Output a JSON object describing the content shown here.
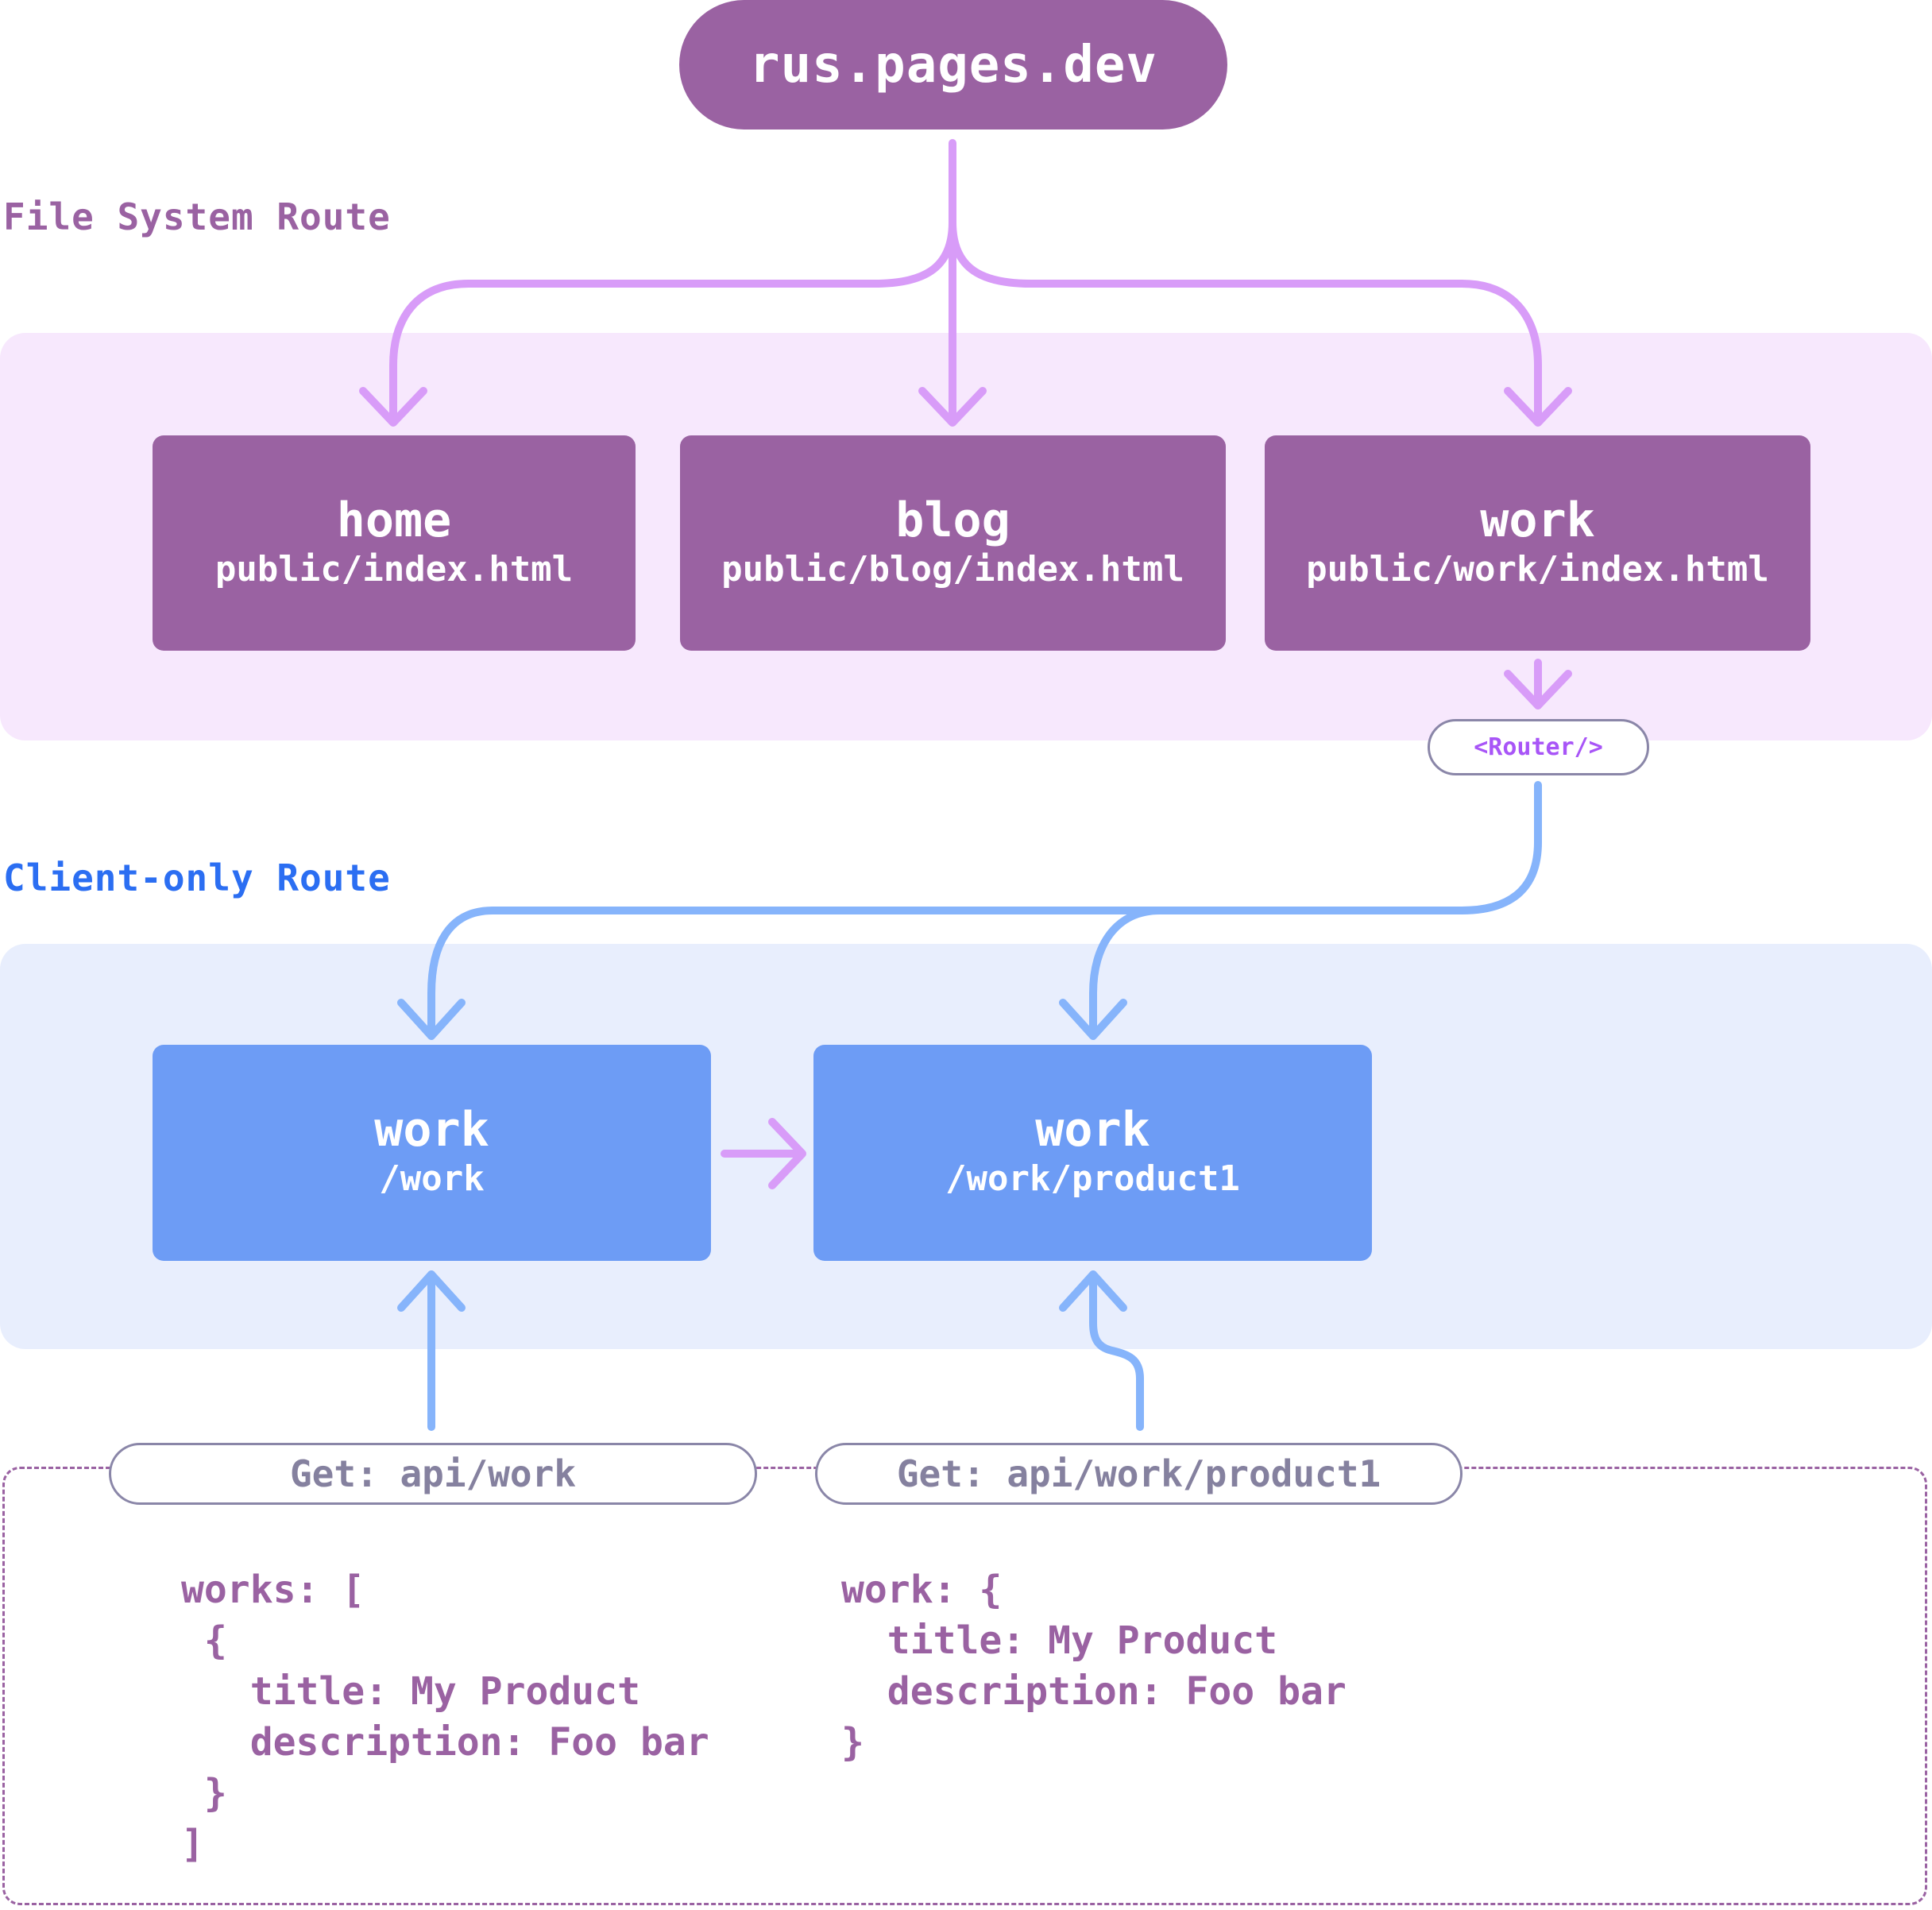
{
  "domain_title": "rus.pages.dev",
  "colors": {
    "purple": "#9a62a2",
    "purple_light_panel": "#f7e8fd",
    "purple_arrow": "#d89cf8",
    "blue": "#6d9cf5",
    "blue_light_panel": "#e8eefd",
    "blue_arrow": "#86b4fb",
    "client_label": "#2b6ef2",
    "router_text": "#a855f7",
    "pill_border": "#8a86a8",
    "get_text": "#85819f"
  },
  "file_system": {
    "label": "File System Route",
    "routes": [
      {
        "title": "home",
        "path": "public/index.html"
      },
      {
        "title": "blog",
        "path": "public/blog/index.html"
      },
      {
        "title": "work",
        "path": "public/work/index.html"
      }
    ],
    "router_label": "<Router/>"
  },
  "client_only": {
    "label": "Client-only Route",
    "routes": [
      {
        "title": "work",
        "path": "/work"
      },
      {
        "title": "work",
        "path": "/work/product1"
      }
    ]
  },
  "api": {
    "requests": [
      {
        "label": "Get: api/work",
        "response_lines": [
          "works: [",
          " {",
          "   title: My Product",
          "   description: Foo bar",
          " }",
          "]"
        ]
      },
      {
        "label": "Get: api/work/product1",
        "response_lines": [
          "work: {",
          "  title: My Product",
          "  description: Foo bar",
          "}"
        ]
      }
    ]
  }
}
